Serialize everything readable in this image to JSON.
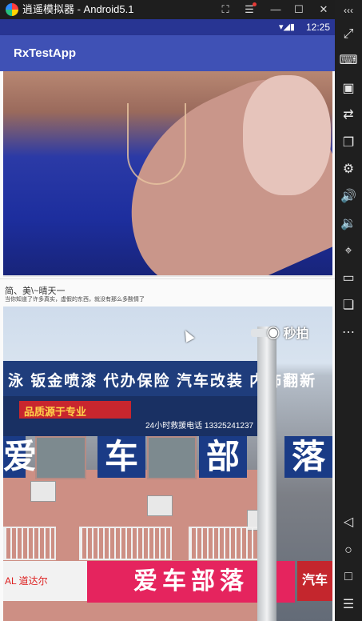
{
  "window": {
    "title": "逍遥模拟器 - Android5.1",
    "buttons": [
      {
        "name": "fullscreen-icon",
        "glyph": "⛶"
      },
      {
        "name": "menu-icon",
        "glyph": "☰"
      },
      {
        "name": "minimize-icon",
        "glyph": "—"
      },
      {
        "name": "maximize-icon",
        "glyph": "☐"
      },
      {
        "name": "close-icon",
        "glyph": "✕"
      }
    ]
  },
  "statusbar": {
    "icons": "▾◢▮",
    "time": "12:25"
  },
  "app": {
    "title": "RxTestApp",
    "accent_color": "#3f51b5",
    "status_color": "#283593"
  },
  "cards": [
    {
      "kind": "image"
    },
    {
      "title": "简、美\\~晴天一",
      "description": "当你知道了许多真实，虚假的东西，就没有那么多酸情了"
    }
  ],
  "photo2": {
    "watermark": "◉ 秒拍",
    "sign_top": "泳 钣金喷漆 代办保险 汽车改装 内饰翻新",
    "sign_red": "品质源于专业",
    "phone": "24小时救援电话 13325241237",
    "big_sign": [
      "爱",
      "车",
      "部",
      "落"
    ],
    "bottom_sign": "爱车部落",
    "bottom_left_sign": "AL 道达尔",
    "bottom_right_sign": "汽车"
  },
  "sidebar": [
    {
      "name": "collapse-icon",
      "glyph": "‹‹‹"
    },
    {
      "name": "resize-icon",
      "glyph": "⤢"
    },
    {
      "name": "keyboard-icon",
      "glyph": "⌨"
    },
    {
      "name": "apk-install-icon",
      "glyph": "▣"
    },
    {
      "name": "sync-icon",
      "glyph": "⇄"
    },
    {
      "name": "multi-window-icon",
      "glyph": "❐"
    },
    {
      "name": "settings-icon",
      "glyph": "⚙"
    },
    {
      "name": "volume-up-icon",
      "glyph": "🔊"
    },
    {
      "name": "volume-down-icon",
      "glyph": "🔉"
    },
    {
      "name": "location-icon",
      "glyph": "⌖"
    },
    {
      "name": "folder-icon",
      "glyph": "▭"
    },
    {
      "name": "copy-icon",
      "glyph": "❏"
    },
    {
      "name": "more-icon",
      "glyph": "⋯"
    },
    {
      "name": "back-icon",
      "glyph": "◁"
    },
    {
      "name": "home-icon",
      "glyph": "○"
    },
    {
      "name": "recents-icon",
      "glyph": "□"
    },
    {
      "name": "list-icon",
      "glyph": "☰"
    }
  ]
}
